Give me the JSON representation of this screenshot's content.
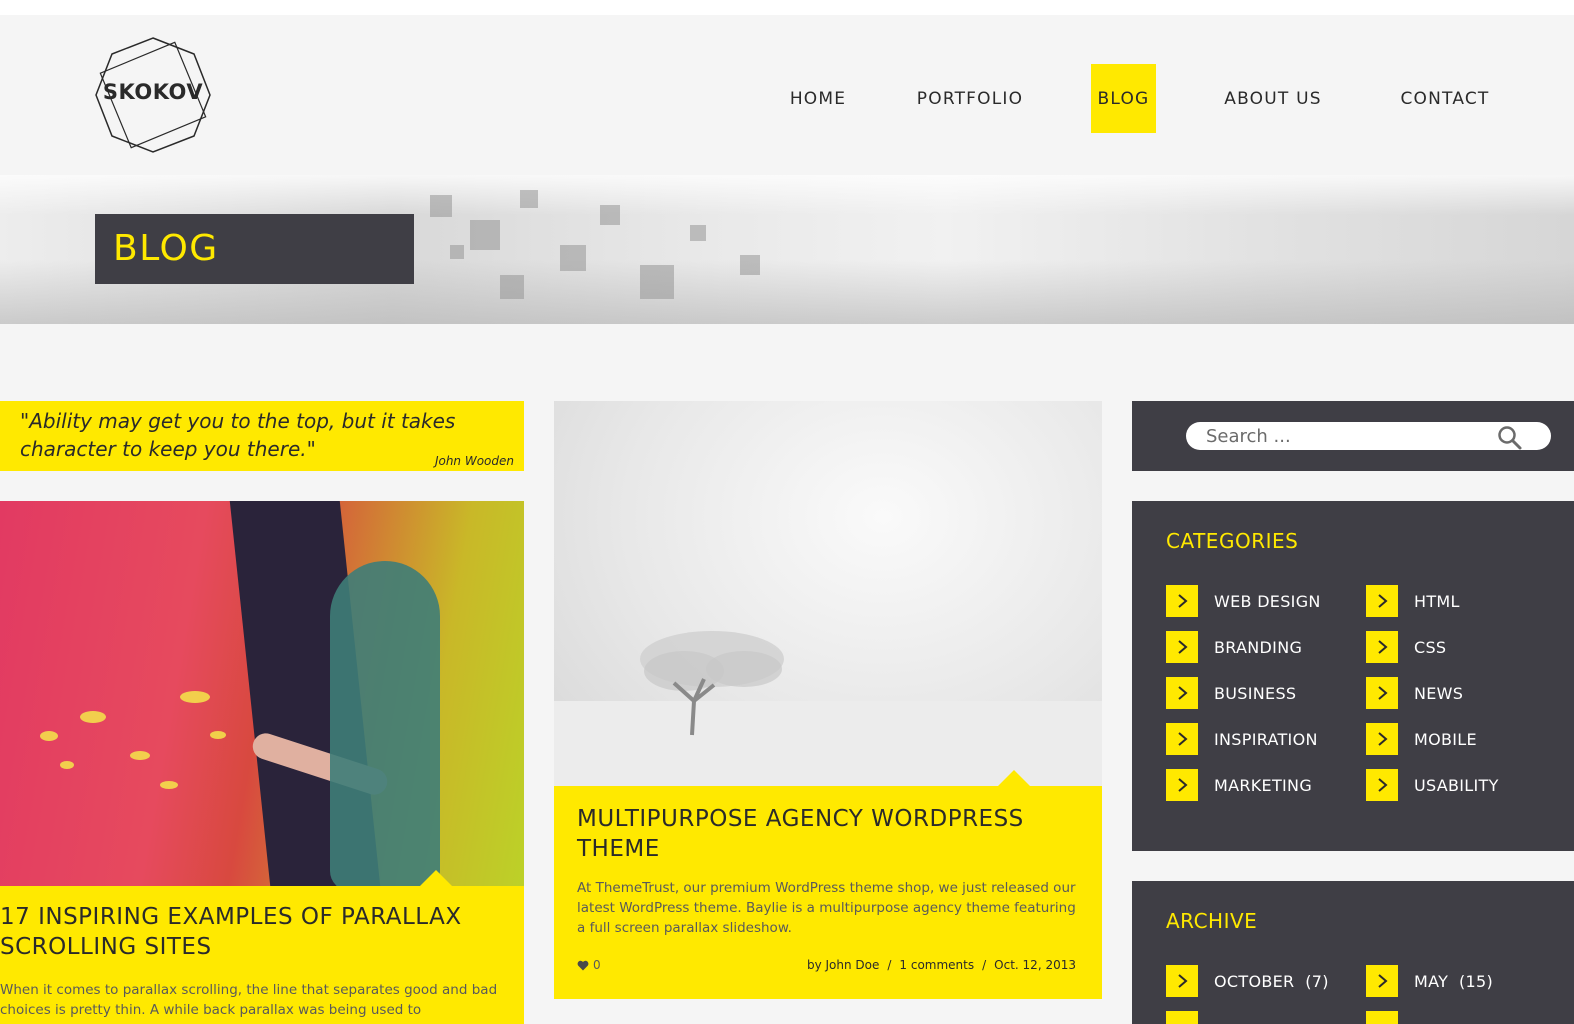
{
  "brand": {
    "logo_text": "SKOKOV"
  },
  "nav": {
    "items": [
      {
        "label": "HOME"
      },
      {
        "label": "PORTFOLIO"
      },
      {
        "label": "BLOG"
      },
      {
        "label": "ABOUT US"
      },
      {
        "label": "CONTACT"
      }
    ],
    "active": "BLOG"
  },
  "hero": {
    "title": "BLOG"
  },
  "quote": {
    "text": "\"Ability may get you to the top, but it takes character to keep you there.\"",
    "author": "John Wooden"
  },
  "posts": [
    {
      "title": "17 INSPIRING EXAMPLES OF PARALLAX SCROLLING SITES",
      "excerpt": "When it comes to parallax scrolling, the line that separates good and bad choices is pretty thin. A while back parallax was being used to"
    },
    {
      "title": "MULTIPURPOSE AGENCY WORDPRESS THEME",
      "excerpt": "At ThemeTrust, our premium WordPress theme shop, we just released our latest WordPress theme. Baylie is a multipurpose agency theme featuring a full screen parallax slideshow.",
      "likes": "0",
      "author": "by John Doe",
      "comments": "1 comments",
      "date": "Oct. 12, 2013",
      "separator": "/"
    }
  ],
  "sidebar": {
    "search": {
      "placeholder": "Search ..."
    },
    "categories": {
      "heading": "CATEGORIES",
      "items": [
        {
          "label": "WEB DESIGN"
        },
        {
          "label": "HTML"
        },
        {
          "label": "BRANDING"
        },
        {
          "label": "CSS"
        },
        {
          "label": "BUSINESS"
        },
        {
          "label": "NEWS"
        },
        {
          "label": "INSPIRATION"
        },
        {
          "label": "MOBILE"
        },
        {
          "label": "MARKETING"
        },
        {
          "label": "USABILITY"
        }
      ]
    },
    "archive": {
      "heading": "ARCHIVE",
      "items": [
        {
          "label": "OCTOBER  (7)"
        },
        {
          "label": "MAY  (15)"
        }
      ]
    }
  },
  "colors": {
    "accent": "#ffe900",
    "dark": "#3f3e45",
    "background": "#f5f5f5",
    "text": "#2a2a2a"
  },
  "icons": {
    "search": "search-icon",
    "arrow": "chevron-right-icon",
    "heart": "heart-icon"
  }
}
